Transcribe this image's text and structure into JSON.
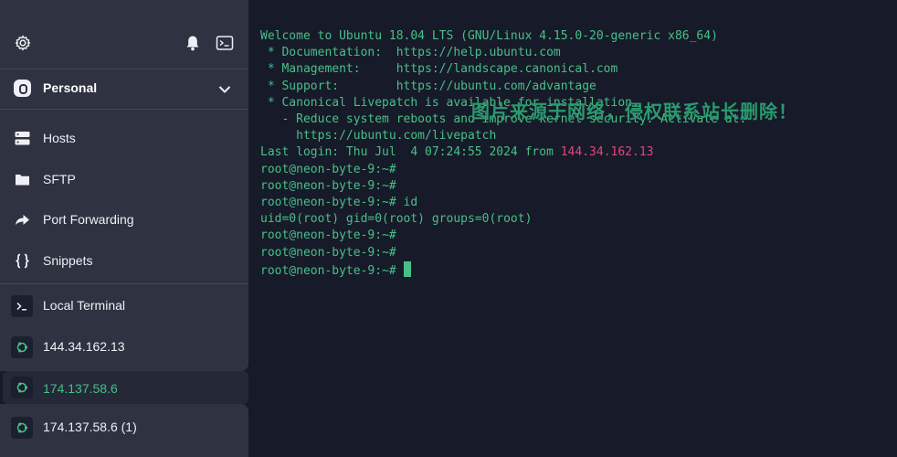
{
  "sidebar": {
    "vault": {
      "label": "Personal"
    },
    "nav": [
      {
        "label": "Hosts",
        "icon": "hosts-icon"
      },
      {
        "label": "SFTP",
        "icon": "folder-icon"
      },
      {
        "label": "Port Forwarding",
        "icon": "port-forwarding-icon"
      },
      {
        "label": "Snippets",
        "icon": "braces-icon"
      }
    ],
    "sessions": [
      {
        "label": "Local Terminal",
        "icon": "terminal-icon"
      },
      {
        "label": "144.34.162.13",
        "icon": "ubuntu-icon"
      },
      {
        "label": "174.137.58.6",
        "icon": "ubuntu-icon",
        "active": true
      },
      {
        "label": "174.137.58.6 (1)",
        "icon": "ubuntu-icon"
      }
    ]
  },
  "terminal": {
    "lines": [
      "Welcome to Ubuntu 18.04 LTS (GNU/Linux 4.15.0-20-generic x86_64)",
      "",
      " * Documentation:  https://help.ubuntu.com",
      " * Management:     https://landscape.canonical.com",
      " * Support:        https://ubuntu.com/advantage",
      "",
      "",
      " * Canonical Livepatch is available for installation.",
      "   - Reduce system reboots and improve kernel security. Activate at:",
      "     https://ubuntu.com/livepatch",
      "",
      "root@neon-byte-9:~#",
      "root@neon-byte-9:~#",
      "root@neon-byte-9:~# id",
      "uid=0(root) gid=0(root) groups=0(root)",
      "root@neon-byte-9:~#",
      "root@neon-byte-9:~#",
      "root@neon-byte-9:~# "
    ],
    "last_login_prefix": "Last login: Thu Jul  4 07:24:55 2024 from ",
    "last_login_ip": "144.34.162.13",
    "watermark": "图片来源于网络，侵权联系站长删除！"
  },
  "colors": {
    "terminal_text": "#47c087",
    "highlight_ip": "#e0487a",
    "sidebar_bg": "#2f3240",
    "terminal_bg": "#171a29"
  }
}
